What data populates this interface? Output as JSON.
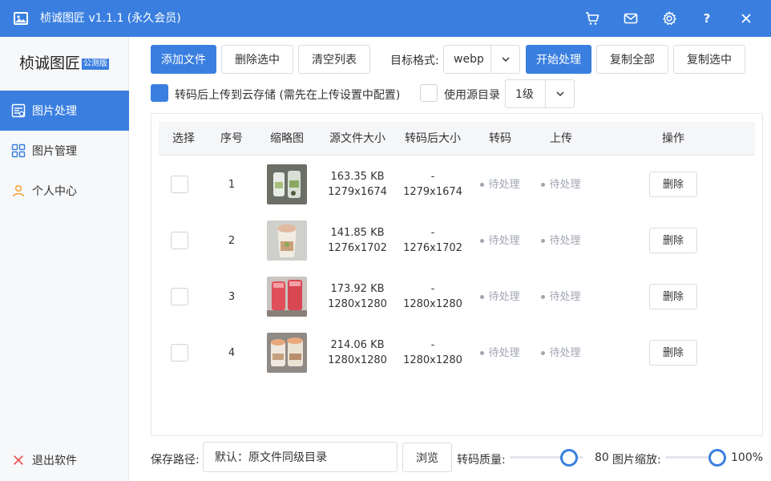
{
  "app": {
    "title": "桢诚图匠 v1.1.1 (永久会员)",
    "logo_text": "桢诚图匠",
    "logo_badge": "公测版",
    "accent": "#3a7fe0"
  },
  "titlebar_icons": [
    "cart-icon",
    "mail-icon",
    "gear-icon",
    "help-icon",
    "close-icon"
  ],
  "titlebar_help": "?",
  "sidebar": {
    "items": [
      {
        "label": "图片处理",
        "icon": "image-process-icon",
        "active": true
      },
      {
        "label": "图片管理",
        "icon": "grid-icon",
        "active": false
      },
      {
        "label": "个人中心",
        "icon": "user-icon",
        "active": false
      }
    ],
    "exit_label": "退出软件"
  },
  "toolbar": {
    "add_file": "添加文件",
    "delete_selected": "删除选中",
    "clear_list": "清空列表",
    "target_format_label": "目标格式:",
    "target_format_value": "webp",
    "start_process": "开始处理",
    "copy_all": "复制全部",
    "copy_selected": "复制选中"
  },
  "options": {
    "upload_cloud_label": "转码后上传到云存储 (需先在上传设置中配置)",
    "upload_cloud_checked": true,
    "use_source_dir_label": "使用源目录",
    "use_source_dir_checked": false,
    "level_value": "1级"
  },
  "table": {
    "headers": {
      "select": "选择",
      "index": "序号",
      "thumb": "缩略图",
      "src_size": "源文件大小",
      "out_size": "转码后大小",
      "transcode": "转码",
      "upload": "上传",
      "action": "操作"
    },
    "rows": [
      {
        "index": "1",
        "src_kb": "163.35 KB",
        "src_dim": "1279x1674",
        "out_kb": "-",
        "out_dim": "1279x1674",
        "transcode": "待处理",
        "upload": "待处理",
        "delete": "删除"
      },
      {
        "index": "2",
        "src_kb": "141.85 KB",
        "src_dim": "1276x1702",
        "out_kb": "-",
        "out_dim": "1276x1702",
        "transcode": "待处理",
        "upload": "待处理",
        "delete": "删除"
      },
      {
        "index": "3",
        "src_kb": "173.92 KB",
        "src_dim": "1280x1280",
        "out_kb": "-",
        "out_dim": "1280x1280",
        "transcode": "待处理",
        "upload": "待处理",
        "delete": "删除"
      },
      {
        "index": "4",
        "src_kb": "214.06 KB",
        "src_dim": "1280x1280",
        "out_kb": "-",
        "out_dim": "1280x1280",
        "transcode": "待处理",
        "upload": "待处理",
        "delete": "删除"
      }
    ]
  },
  "bottom": {
    "save_path_label": "保存路径:",
    "save_path_value": "默认：原文件同级目录",
    "browse": "浏览",
    "quality_label": "转码质量:",
    "quality_value": "80",
    "quality_fraction": 0.8,
    "scale_label": "图片缩放:",
    "scale_value": "100%",
    "scale_fraction": 1.0
  }
}
